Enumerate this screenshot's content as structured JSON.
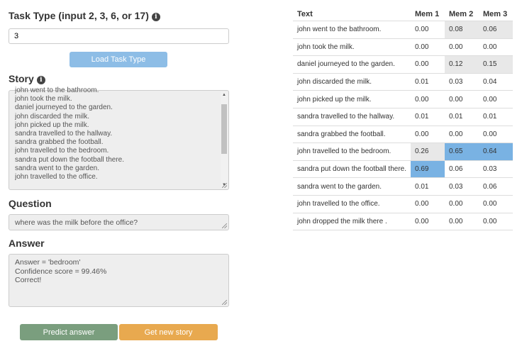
{
  "task_type": {
    "label": "Task Type (input 2, 3, 6, or 17)",
    "info_icon": "info-circle-icon",
    "input_value": "3",
    "load_button": "Load Task Type"
  },
  "story": {
    "label": "Story",
    "info_icon": "info-circle-icon",
    "lines": [
      "john went to the bathroom.",
      "john took the milk.",
      "daniel journeyed to the garden.",
      "john discarded the milk.",
      "john picked up the milk.",
      "sandra travelled to the hallway.",
      "sandra grabbed the football.",
      "john travelled to the bedroom.",
      "sandra put down the football there.",
      "sandra went to the garden.",
      "john travelled to the office."
    ]
  },
  "question": {
    "label": "Question",
    "value": "where was the milk before the office?"
  },
  "answer": {
    "label": "Answer",
    "lines": [
      "Answer = 'bedroom'",
      "Confidence score = 99.46%",
      "Correct!"
    ]
  },
  "buttons": {
    "predict": "Predict answer",
    "new_story": "Get new story"
  },
  "colors": {
    "load_button": "#8dbde6",
    "predict_button": "#7a9e7e",
    "new_story_button": "#e8a94f",
    "highlight_strong": "#79b2e3",
    "highlight_weak": "#e8e8e8"
  },
  "memory_table": {
    "headers": [
      "Text",
      "Mem 1",
      "Mem 2",
      "Mem 3"
    ],
    "rows": [
      {
        "text": "john went to the bathroom.",
        "m": [
          "0.00",
          "0.08",
          "0.06"
        ],
        "hl": [
          "",
          "w",
          "w"
        ]
      },
      {
        "text": "john took the milk.",
        "m": [
          "0.00",
          "0.00",
          "0.00"
        ],
        "hl": [
          "",
          "",
          ""
        ]
      },
      {
        "text": "daniel journeyed to the garden.",
        "m": [
          "0.00",
          "0.12",
          "0.15"
        ],
        "hl": [
          "",
          "w",
          "w"
        ]
      },
      {
        "text": "john discarded the milk.",
        "m": [
          "0.01",
          "0.03",
          "0.04"
        ],
        "hl": [
          "",
          "",
          ""
        ]
      },
      {
        "text": "john picked up the milk.",
        "m": [
          "0.00",
          "0.00",
          "0.00"
        ],
        "hl": [
          "",
          "",
          ""
        ]
      },
      {
        "text": "sandra travelled to the hallway.",
        "m": [
          "0.01",
          "0.01",
          "0.01"
        ],
        "hl": [
          "",
          "",
          ""
        ]
      },
      {
        "text": "sandra grabbed the football.",
        "m": [
          "0.00",
          "0.00",
          "0.00"
        ],
        "hl": [
          "",
          "",
          ""
        ]
      },
      {
        "text": "john travelled to the bedroom.",
        "m": [
          "0.26",
          "0.65",
          "0.64"
        ],
        "hl": [
          "w",
          "s",
          "s"
        ]
      },
      {
        "text": "sandra put down the football there.",
        "m": [
          "0.69",
          "0.06",
          "0.03"
        ],
        "hl": [
          "s",
          "",
          ""
        ]
      },
      {
        "text": "sandra went to the garden.",
        "m": [
          "0.01",
          "0.03",
          "0.06"
        ],
        "hl": [
          "",
          "",
          ""
        ]
      },
      {
        "text": "john travelled to the office.",
        "m": [
          "0.00",
          "0.00",
          "0.00"
        ],
        "hl": [
          "",
          "",
          ""
        ]
      },
      {
        "text": "john dropped the milk there .",
        "m": [
          "0.00",
          "0.00",
          "0.00"
        ],
        "hl": [
          "",
          "",
          ""
        ]
      }
    ]
  }
}
